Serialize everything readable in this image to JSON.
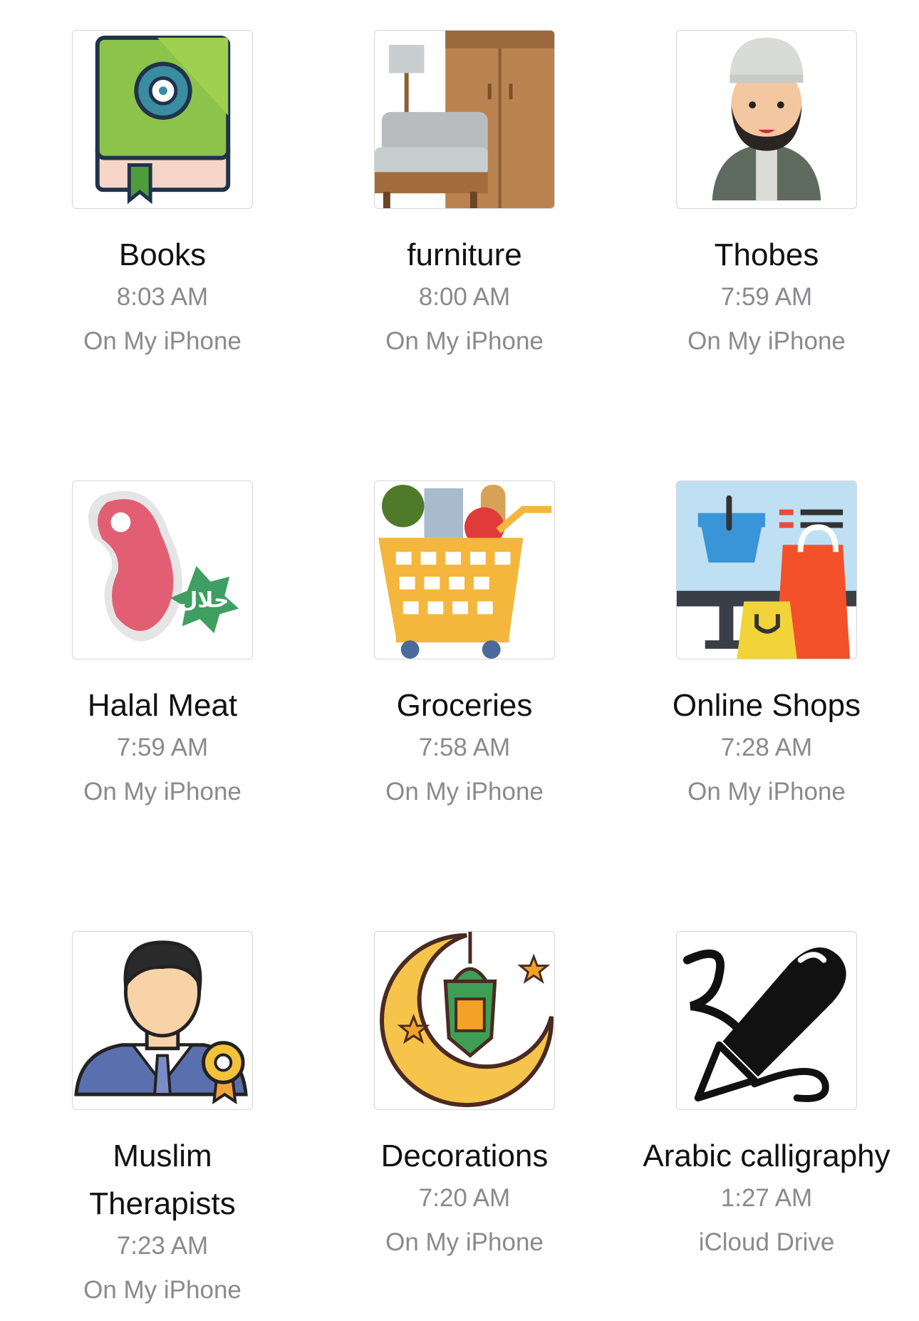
{
  "files": [
    {
      "name": "Books",
      "time": "8:03 AM",
      "location": "On My iPhone",
      "icon": "book-icon"
    },
    {
      "name": "furniture",
      "time": "8:00 AM",
      "location": "On My iPhone",
      "icon": "furniture-icon"
    },
    {
      "name": "Thobes",
      "time": "7:59 AM",
      "location": "On My iPhone",
      "icon": "man-thobe-icon"
    },
    {
      "name": "Halal Meat",
      "time": "7:59 AM",
      "location": "On My iPhone",
      "icon": "halal-meat-icon"
    },
    {
      "name": "Groceries",
      "time": "7:58 AM",
      "location": "On My iPhone",
      "icon": "grocery-cart-icon"
    },
    {
      "name": "Online Shops",
      "time": "7:28 AM",
      "location": "On My iPhone",
      "icon": "online-shop-icon"
    },
    {
      "name_line1": "Muslim",
      "name_line2": "Therapists",
      "time": "7:23 AM",
      "location": "On My iPhone",
      "icon": "therapist-icon"
    },
    {
      "name": "Decorations",
      "time": "7:20 AM",
      "location": "On My iPhone",
      "icon": "crescent-lantern-icon"
    },
    {
      "name": "Arabic calligraphy",
      "time": "1:27 AM",
      "location": "iCloud Drive",
      "icon": "calligraphy-pen-icon"
    }
  ]
}
